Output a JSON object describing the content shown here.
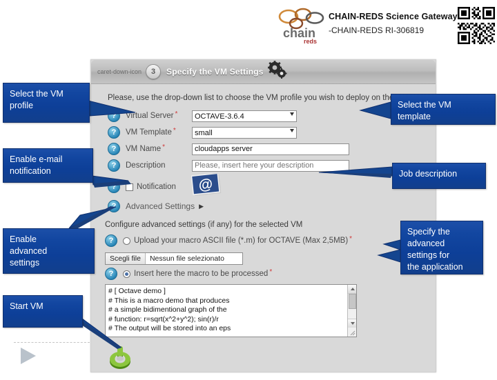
{
  "header": {
    "title": "CHAIN-REDS Science Gateway",
    "subtitle": "-CHAIN-REDS RI-306819",
    "logo_text_main": "chain",
    "logo_text_sub": "reds",
    "logo_icon": "chain-reds-logo",
    "qr_icon": "qr-code"
  },
  "portlet": {
    "step_number": "3",
    "title": "Specify the VM Settings",
    "collapse_icon": "caret-down-icon",
    "gear_icon": "gears-icon",
    "intro": "Please, use the drop-down list to choose the VM profile you wish to deploy on the clo",
    "fields": [
      {
        "label": "Virtual Server",
        "required": "*",
        "value": "OCTAVE-3.6.4",
        "help_icon": "help-icon",
        "control": "select"
      },
      {
        "label": "VM Template",
        "required": "*",
        "value": "small",
        "help_icon": "help-icon",
        "control": "select"
      },
      {
        "label": "VM Name",
        "required": "*",
        "value": "cloudapps server",
        "help_icon": "help-icon",
        "control": "text"
      },
      {
        "label": "Description",
        "required": "",
        "value": "",
        "placeholder": "Please, insert here your description",
        "help_icon": "help-icon",
        "control": "text"
      }
    ],
    "notification": {
      "label": "Notification",
      "checked": false,
      "help_icon": "help-icon",
      "mail_icon": "at-email-icon"
    },
    "advanced_toggle": {
      "label": "Advanced Settings",
      "caret": "▶",
      "help_icon": "help-icon"
    },
    "advanced": {
      "note": "Configure advanced settings (if any) for the selected VM",
      "option_upload": {
        "label": "Upload your macro ASCII file (*.m) for OCTAVE (Max 2,5MB)",
        "required": "*",
        "selected": false,
        "help_icon": "help-icon"
      },
      "file_input": {
        "button_label": "Scegli file",
        "file_name": "Nessun file selezionato"
      },
      "option_insert": {
        "label": "Insert here the macro to be processed",
        "required": "*",
        "selected": true,
        "help_icon": "help-icon"
      },
      "macro_text": "# [ Octave demo ]\n# This is a macro demo that produces\n# a simple bidimentional graph of the\n# function: r=sqrt(x^2+y^2); sin(r)/r\n# The output will be stored into an eps"
    },
    "start_button_icon": "green-power-start-icon"
  },
  "callouts": {
    "profile": [
      "Select the VM",
      "profile"
    ],
    "email": [
      "Enable e-mail",
      "notification"
    ],
    "advanced": [
      "Enable",
      "advanced",
      "settings"
    ],
    "start": [
      "Start VM"
    ],
    "template": [
      "Select the VM",
      "template"
    ],
    "job": [
      "Job description"
    ],
    "specify": [
      "Specify the",
      "advanced",
      "settings for",
      "the application"
    ]
  },
  "slide_nav": {
    "next_icon": "play-triangle-icon"
  },
  "colors": {
    "callout_blue": "#0d3f98",
    "callout_border": "#10306e",
    "portlet_bg": "#d9d9d9",
    "help_icon_blue": "#2a87b8",
    "required_red": "#cf3a3a",
    "start_green": "#76b82a"
  }
}
